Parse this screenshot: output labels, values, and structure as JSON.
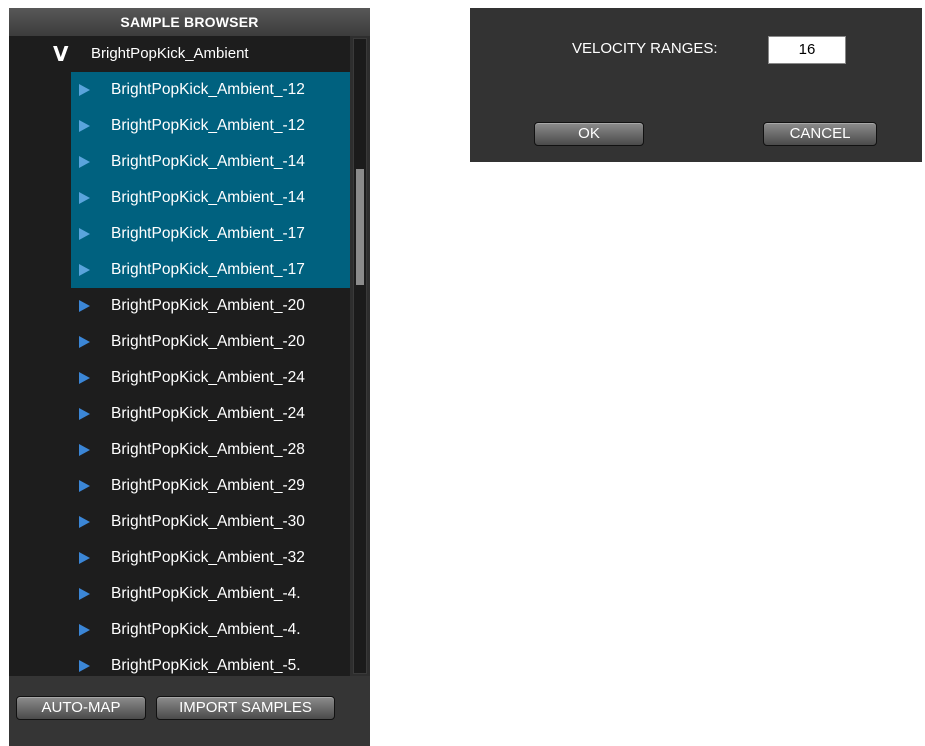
{
  "browser": {
    "title": "SAMPLE BROWSER",
    "folder": {
      "chevron": "V",
      "name": "BrightPopKick_Ambient"
    },
    "items": [
      {
        "name": "BrightPopKick_Ambient_-12",
        "selected": true
      },
      {
        "name": "BrightPopKick_Ambient_-12",
        "selected": true
      },
      {
        "name": "BrightPopKick_Ambient_-14",
        "selected": true
      },
      {
        "name": "BrightPopKick_Ambient_-14",
        "selected": true
      },
      {
        "name": "BrightPopKick_Ambient_-17",
        "selected": true
      },
      {
        "name": "BrightPopKick_Ambient_-17",
        "selected": true
      },
      {
        "name": "BrightPopKick_Ambient_-20",
        "selected": false
      },
      {
        "name": "BrightPopKick_Ambient_-20",
        "selected": false
      },
      {
        "name": "BrightPopKick_Ambient_-24",
        "selected": false
      },
      {
        "name": "BrightPopKick_Ambient_-24",
        "selected": false
      },
      {
        "name": "BrightPopKick_Ambient_-28",
        "selected": false
      },
      {
        "name": "BrightPopKick_Ambient_-29",
        "selected": false
      },
      {
        "name": "BrightPopKick_Ambient_-30",
        "selected": false
      },
      {
        "name": "BrightPopKick_Ambient_-32",
        "selected": false
      },
      {
        "name": "BrightPopKick_Ambient_-4.",
        "selected": false
      },
      {
        "name": "BrightPopKick_Ambient_-4.",
        "selected": false
      },
      {
        "name": "BrightPopKick_Ambient_-5.",
        "selected": false
      }
    ],
    "buttons": {
      "auto_map": "AUTO-MAP",
      "import_samples": "IMPORT SAMPLES"
    }
  },
  "dialog": {
    "velocity_label": "VELOCITY RANGES:",
    "velocity_value": "16",
    "ok_label": "OK",
    "cancel_label": "CANCEL"
  },
  "colors": {
    "selection": "#00617f",
    "play_icon": "#3b86d6",
    "panel_bg": "#1d1d1d"
  }
}
